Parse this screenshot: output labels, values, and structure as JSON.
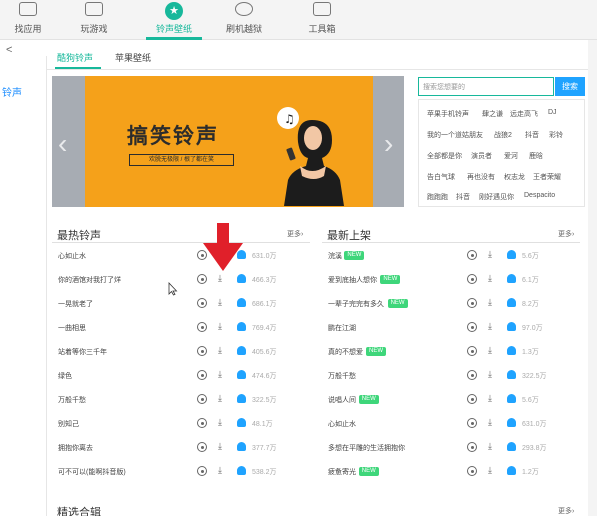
{
  "topnav": {
    "items": [
      {
        "label": "找应用",
        "icon": "app-icon"
      },
      {
        "label": "玩游戏",
        "icon": "gamepad-icon"
      },
      {
        "label": "铃声壁纸",
        "icon": "star-icon",
        "active": true
      },
      {
        "label": "刷机越狱",
        "icon": "refresh-icon"
      },
      {
        "label": "工具箱",
        "icon": "toolbox-icon"
      }
    ]
  },
  "back_label": "<",
  "leftnav": {
    "current": "铃声"
  },
  "subtabs": [
    {
      "label": "酷狗铃声",
      "active": true
    },
    {
      "label": "苹果壁纸",
      "active": false
    }
  ],
  "banner": {
    "title": "搞笑铃声",
    "subtitle": "欢脱无极限 / 根了都在笑"
  },
  "search": {
    "placeholder": "搜索您想要的",
    "button_label": "搜索"
  },
  "tags": [
    [
      "苹果手机铃声",
      "肆之谦",
      "远走高飞",
      "DJ"
    ],
    [
      "我的一个道姑朋友",
      "战狼2",
      "抖音",
      "彩铃"
    ],
    [
      "全部都是你",
      "演员者",
      "爱河",
      "鹿晗"
    ],
    [
      "告白气球",
      "再也没有",
      "权志龙",
      "王者荣耀"
    ],
    [
      "跑跑跑",
      "抖音",
      "刚好遇见你",
      "Despacito"
    ]
  ],
  "colors": {
    "accent": "#17b89b",
    "blue": "#1fa3ff",
    "new_badge": "#3ed67a",
    "arrow": "#e0202a"
  },
  "hot": {
    "title": "最热铃声",
    "more": "更多›",
    "rows": [
      {
        "name": "心如止水",
        "count": "631.0万"
      },
      {
        "name": "你的酒馆对我打了烊",
        "count": "466.3万"
      },
      {
        "name": "一晃就老了",
        "count": "686.1万"
      },
      {
        "name": "一曲相思",
        "count": "769.4万"
      },
      {
        "name": "站着等你三千年",
        "count": "405.6万"
      },
      {
        "name": "绿色",
        "count": "474.6万"
      },
      {
        "name": "万般千愁",
        "count": "322.5万"
      },
      {
        "name": "别知己",
        "count": "48.1万"
      },
      {
        "name": "拥抱你离去",
        "count": "377.7万"
      },
      {
        "name": "可不可以(能啊抖音版)",
        "count": "538.2万"
      }
    ]
  },
  "latest": {
    "title": "最新上架",
    "more": "更多›",
    "rows": [
      {
        "name": "浣溪",
        "new": true,
        "count": "5.6万"
      },
      {
        "name": "爱到底抽人想你",
        "new": true,
        "count": "6.1万"
      },
      {
        "name": "一辈子完完有多久",
        "new": true,
        "count": "8.2万"
      },
      {
        "name": "鹏在江湖",
        "new": false,
        "count": "97.0万"
      },
      {
        "name": "真的不想爱",
        "new": true,
        "count": "1.3万"
      },
      {
        "name": "万般千愁",
        "new": false,
        "count": "322.5万"
      },
      {
        "name": "说唱人间",
        "new": true,
        "count": "5.6万"
      },
      {
        "name": "心如止水",
        "new": false,
        "count": "631.0万"
      },
      {
        "name": "多想在平雕的生活拥抱你",
        "new": false,
        "count": "293.8万"
      },
      {
        "name": "疲惫寄光",
        "new": true,
        "count": "1.2万"
      }
    ]
  },
  "bottom": {
    "title": "精选合辑",
    "more": "更多›"
  }
}
